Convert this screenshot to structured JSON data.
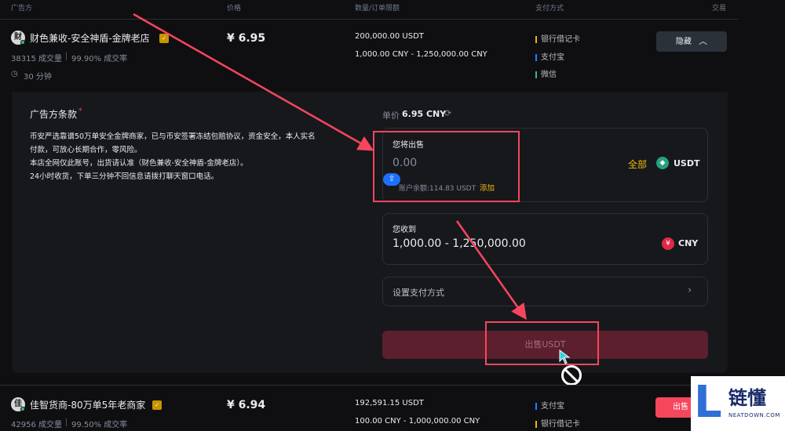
{
  "columns": {
    "advertiser": "广告方",
    "price": "价格",
    "amount": "数量/订单限额",
    "payment": "支付方式",
    "trade": "交易"
  },
  "ad1": {
    "avatar": "财",
    "name": "财色兼收-安全神盾-金牌老店",
    "orders": "38315 成交量",
    "completion": "99.90% 成交率",
    "time": "30 分钟",
    "price": "¥ 6.95",
    "available": "200,000.00 USDT",
    "limit": "1,000.00 CNY - 1,250,000.00 CNY",
    "payments": [
      {
        "name": "银行借记卡",
        "color": "#f0b90b"
      },
      {
        "name": "支付宝",
        "color": "#1e80ff"
      },
      {
        "name": "微信",
        "color": "#2ebd85"
      }
    ],
    "hide_label": "隐藏"
  },
  "panel": {
    "terms_title": "广告方条款",
    "terms_star": "*",
    "terms_lines": [
      "币安严选靠谱50万单安全金牌商家，已与币安签署冻结包赔协议，资金安全，本人实名",
      "付款，可放心长期合作，零风险。",
      "本店全网仅此账号，出货请认准（财色兼收-安全神盾-金牌老店）。",
      "24小时收货，下单三分钟不回信息请拨打聊天窗口电话。"
    ],
    "unit_price_label": "单价",
    "unit_price": "6.95 CNY",
    "sell_label": "您将出售",
    "sell_value": "0.00",
    "all_label": "全部",
    "sell_currency": "USDT",
    "balance": "账户余额:114.83 USDT",
    "add_label": "添加",
    "receive_label": "您收到",
    "receive_value": "1,000.00 - 1,250,000.00",
    "receive_currency": "CNY",
    "receive_icon": "¥",
    "payment_method_label": "设置支付方式",
    "sell_button": "出售USDT"
  },
  "ad2": {
    "avatar": "佳",
    "name": "佳智货商-80万单5年老商家",
    "orders": "42956 成交量",
    "completion": "99.50% 成交率",
    "price": "¥ 6.94",
    "available": "192,591.15 USDT",
    "limit": "100.00 CNY - 1,000,000.00 CNY",
    "payments": [
      {
        "name": "支付宝",
        "color": "#1e80ff"
      },
      {
        "name": "银行借记卡",
        "color": "#f0b90b"
      }
    ],
    "sell_label": "出售"
  },
  "watermark": {
    "letter": "L",
    "text": "链懂",
    "url": "NEATDOWN.COM"
  },
  "colors": {
    "accent": "#f0b90b",
    "sell": "#f6465d",
    "annotation": "#f6465d",
    "panel_bg": "#17181c"
  }
}
